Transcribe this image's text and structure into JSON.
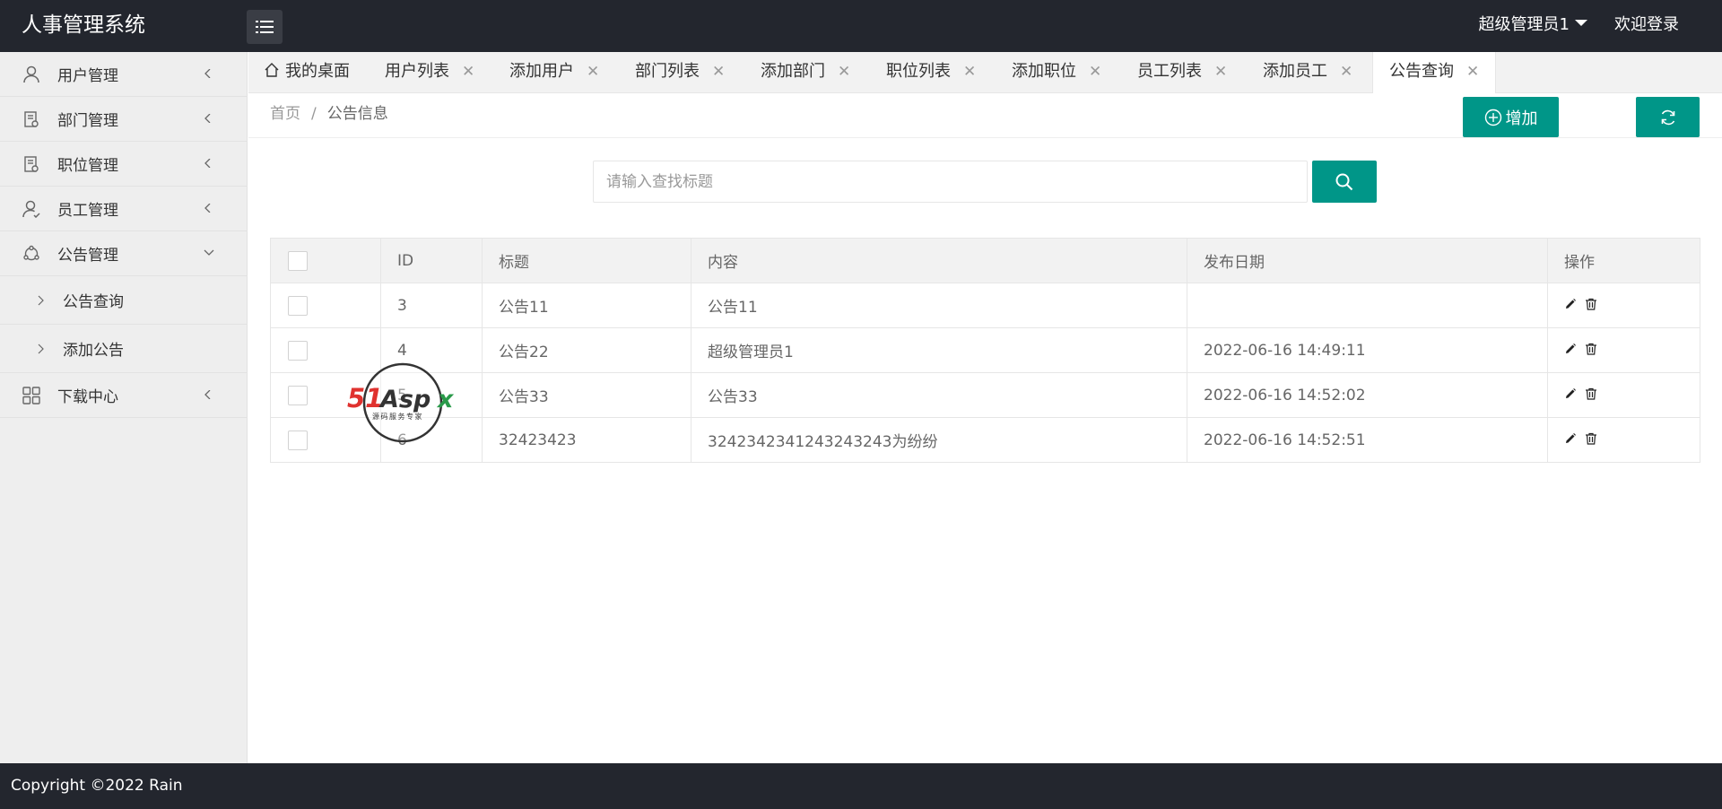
{
  "app": {
    "title": "人事管理系统",
    "user_name": "超级管理员1",
    "welcome": "欢迎登录"
  },
  "sidebar": {
    "items": [
      {
        "label": "用户管理",
        "icon": "user-icon"
      },
      {
        "label": "部门管理",
        "icon": "department-icon"
      },
      {
        "label": "职位管理",
        "icon": "position-icon"
      },
      {
        "label": "员工管理",
        "icon": "employee-icon"
      },
      {
        "label": "公告管理",
        "icon": "notice-icon",
        "expanded": true,
        "children": [
          {
            "label": "公告查询"
          },
          {
            "label": "添加公告"
          }
        ]
      },
      {
        "label": "下载中心",
        "icon": "grid-icon"
      }
    ]
  },
  "tabs": [
    {
      "label": "我的桌面",
      "closable": false
    },
    {
      "label": "用户列表",
      "closable": true
    },
    {
      "label": "添加用户",
      "closable": true
    },
    {
      "label": "部门列表",
      "closable": true
    },
    {
      "label": "添加部门",
      "closable": true
    },
    {
      "label": "职位列表",
      "closable": true
    },
    {
      "label": "添加职位",
      "closable": true
    },
    {
      "label": "员工列表",
      "closable": true
    },
    {
      "label": "添加员工",
      "closable": true
    },
    {
      "label": "公告查询",
      "closable": true,
      "active": true
    }
  ],
  "breadcrumb": {
    "home": "首页",
    "separator": "/",
    "current": "公告信息"
  },
  "toolbar": {
    "add_label": "增加"
  },
  "search": {
    "placeholder": "请输入查找标题",
    "value": ""
  },
  "table": {
    "headers": [
      "ID",
      "标题",
      "内容",
      "发布日期",
      "操作"
    ],
    "rows": [
      {
        "id": "3",
        "title": "公告11",
        "content": "公告11",
        "date": ""
      },
      {
        "id": "4",
        "title": "公告22",
        "content": "超级管理员1",
        "date": "2022-06-16 14:49:11"
      },
      {
        "id": "5",
        "title": "公告33",
        "content": "公告33",
        "date": "2022-06-16 14:52:02"
      },
      {
        "id": "6",
        "title": "32423423",
        "content": "3242342341243243243为纷纷",
        "date": "2022-06-16 14:52:51"
      }
    ]
  },
  "watermark": {
    "brand": "51Aspx",
    "tagline": "源码服务专家"
  },
  "footer": {
    "copyright": "Copyright ©2022 Rain"
  },
  "colors": {
    "accent": "#009688",
    "header_bg": "#23262e",
    "sidebar_bg": "#eeeeee"
  }
}
